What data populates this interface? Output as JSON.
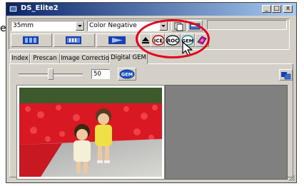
{
  "window": {
    "title": "DS_Elite2"
  },
  "caption_buttons": {
    "minimize": "_",
    "maximize": "□",
    "close": "x"
  },
  "toolbar": {
    "film_format": "35mm",
    "film_type": "Color Negative",
    "icon_buttons": [
      {
        "label": "ICE"
      },
      {
        "label": "ROC"
      },
      {
        "label": "GEM"
      }
    ]
  },
  "tabs": [
    {
      "label": "Index",
      "active": false
    },
    {
      "label": "Prescan",
      "active": false
    },
    {
      "label": "Image Correction",
      "active": false
    },
    {
      "label": "Digital GEM",
      "active": true
    }
  ],
  "gem": {
    "slider_value": "50",
    "slider_fraction": 0.5,
    "button_label": "GEM"
  },
  "colors": {
    "highlight": "#e2001a",
    "title_start": "#0a246a",
    "title_end": "#a6caf0"
  },
  "left_edge_text": "e"
}
